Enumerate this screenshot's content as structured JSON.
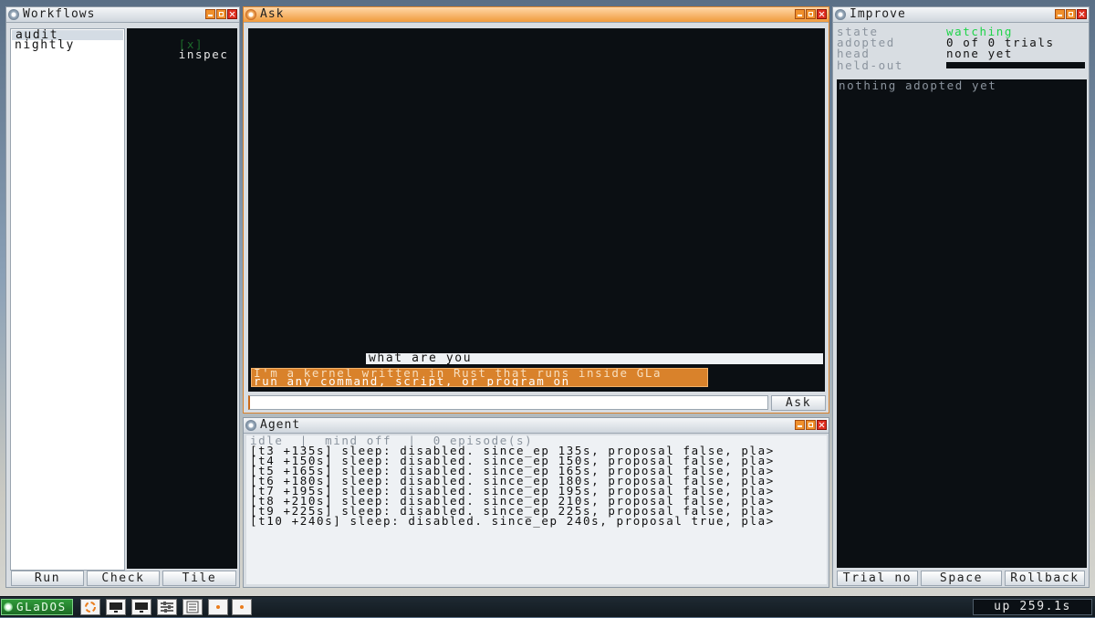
{
  "workflows": {
    "title": "Workflows",
    "items": [
      "audit",
      "nightly"
    ],
    "selected": "audit",
    "preview_line": {
      "mark": "[x]",
      "text": "inspec"
    },
    "buttons": {
      "run": "Run",
      "check": "Check",
      "tile": "Tile"
    }
  },
  "ask": {
    "title": "Ask",
    "user_message": "what are you",
    "reply_lines": [
      "I'm a kernel written in Rust that runs inside GLa",
      "run any command, script, or program on"
    ],
    "input_value": "",
    "button": "Ask"
  },
  "agent": {
    "title": "Agent",
    "status": "idle  |  mind off  |  0 episode(s)",
    "log": [
      "[t3 +135s] sleep: disabled. since_ep 135s, proposal false, pla>",
      "[t4 +150s] sleep: disabled. since_ep 150s, proposal false, pla>",
      "[t5 +165s] sleep: disabled. since_ep 165s, proposal false, pla>",
      "[t6 +180s] sleep: disabled. since_ep 180s, proposal false, pla>",
      "[t7 +195s] sleep: disabled. since_ep 195s, proposal false, pla>",
      "[t8 +210s] sleep: disabled. since_ep 210s, proposal false, pla>",
      "[t9 +225s] sleep: disabled. since_ep 225s, proposal false, pla>",
      "[t10 +240s] sleep: disabled. since_ep 240s, proposal true, pla>"
    ]
  },
  "improve": {
    "title": "Improve",
    "fields": [
      {
        "label": "state",
        "value": "watching"
      },
      {
        "label": "adopted",
        "value": "0 of 0 trials"
      },
      {
        "label": "head",
        "value": "none yet"
      },
      {
        "label": "held-out",
        "value": ""
      }
    ],
    "empty_text": "nothing adopted yet",
    "buttons": {
      "trial": "Trial no",
      "space": "Space",
      "rollback": "Rollback"
    }
  },
  "taskbar": {
    "start_label": "GLaDOS",
    "uptime": "up 259.1s",
    "icons": [
      "loader-icon",
      "monitor-icon",
      "monitor-icon",
      "sliders-icon",
      "notes-icon",
      "dot-icon",
      "dot-icon"
    ]
  },
  "colors": {
    "accent": "#f0902c",
    "close": "#e02f21",
    "watching": "#1fd44a",
    "panel_dark": "#0b0f13"
  }
}
